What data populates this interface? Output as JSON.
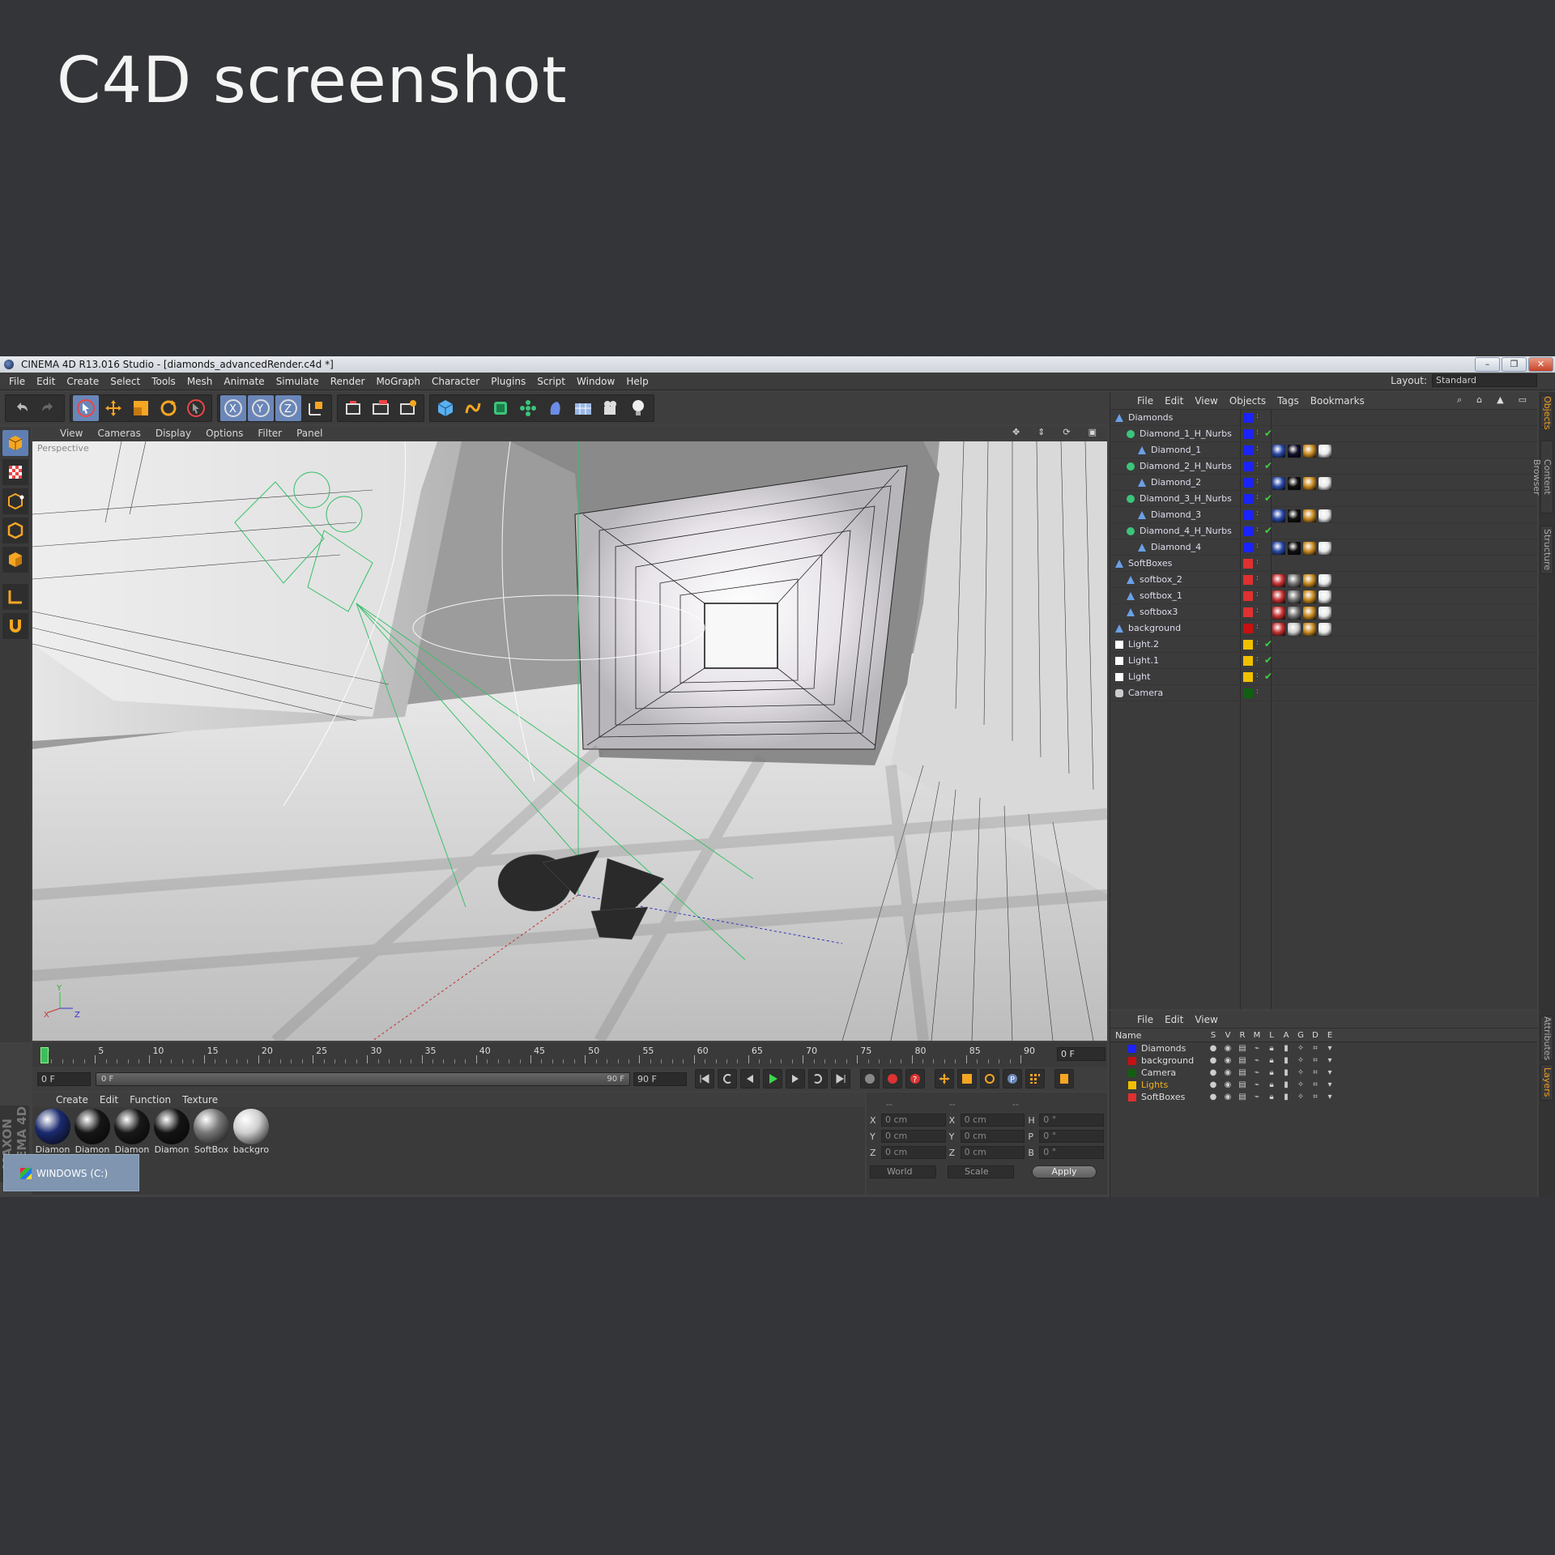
{
  "heading": "C4D screenshot",
  "window": {
    "title": "CINEMA 4D R13.016 Studio - [diamonds_advancedRender.c4d *]",
    "buttons": [
      "–",
      "❐",
      "✕"
    ]
  },
  "menu": [
    "File",
    "Edit",
    "Create",
    "Select",
    "Tools",
    "Mesh",
    "Animate",
    "Simulate",
    "Render",
    "MoGraph",
    "Character",
    "Plugins",
    "Script",
    "Window",
    "Help"
  ],
  "layout": {
    "label": "Layout:",
    "value": "Standard"
  },
  "toolbar_icons": [
    "undo-icon",
    "redo-icon",
    "select-arrow-icon",
    "move-icon",
    "scale-icon",
    "rotate-icon",
    "live-select-icon",
    "x-axis-icon",
    "y-axis-icon",
    "z-axis-icon",
    "coordinate-system-icon",
    "render-view-icon",
    "render-picture-viewer-icon",
    "render-settings-icon",
    "cube-icon",
    "spline-pen-icon",
    "nurbs-icon",
    "array-icon",
    "deformer-icon",
    "scene-floor-icon",
    "camera-icon",
    "light-icon"
  ],
  "left_tools": [
    "model-mode-icon",
    "texture-mode-icon",
    "point-mode-icon",
    "edge-mode-icon",
    "polygon-mode-icon",
    "axis-mode-icon",
    "magnet-icon"
  ],
  "viewport": {
    "menu": [
      "View",
      "Cameras",
      "Display",
      "Options",
      "Filter",
      "Panel"
    ],
    "label": "Perspective",
    "axis_labels": [
      "X",
      "Y",
      "Z"
    ]
  },
  "timeline": {
    "ticks": [
      "0",
      "5",
      "10",
      "15",
      "20",
      "25",
      "30",
      "35",
      "40",
      "45",
      "50",
      "55",
      "60",
      "65",
      "70",
      "75",
      "80",
      "85",
      "90"
    ],
    "current_frame": "0 F",
    "start": "0 F",
    "slider_left": "0 F",
    "slider_right": "90 F",
    "end": "90 F"
  },
  "material_manager": {
    "menu": [
      "Create",
      "Edit",
      "Function",
      "Texture"
    ],
    "materials": [
      {
        "name": "Diamon",
        "color": "#1a2a6e"
      },
      {
        "name": "Diamon",
        "color": "#161616"
      },
      {
        "name": "Diamon",
        "color": "#181818"
      },
      {
        "name": "Diamon",
        "color": "#141414"
      },
      {
        "name": "SoftBox",
        "color": "#777777"
      },
      {
        "name": "backgro",
        "color": "#cfcfcf"
      }
    ]
  },
  "maxon_label": "MAXON CINEMA 4D",
  "taskbar": {
    "label": "WINDOWS (C:)"
  },
  "coordinates": {
    "header": [
      "--",
      "--",
      "--"
    ],
    "rows": [
      {
        "a": "X",
        "av": "0 cm",
        "b": "X",
        "bv": "0 cm",
        "c": "H",
        "cv": "0 °"
      },
      {
        "a": "Y",
        "av": "0 cm",
        "b": "Y",
        "bv": "0 cm",
        "c": "P",
        "cv": "0 °"
      },
      {
        "a": "Z",
        "av": "0 cm",
        "b": "Z",
        "bv": "0 cm",
        "c": "B",
        "cv": "0 °"
      }
    ],
    "world": "World",
    "scale": "Scale",
    "apply": "Apply"
  },
  "object_manager": {
    "menu": [
      "File",
      "Edit",
      "View",
      "Objects",
      "Tags",
      "Bookmarks"
    ],
    "objects": [
      {
        "name": "Diamonds",
        "indent": 0,
        "color": "#1a22ff",
        "check": "",
        "tags": []
      },
      {
        "name": "Diamond_1_H_Nurbs",
        "indent": 1,
        "color": "#1a22ff",
        "check": "✔",
        "tags": []
      },
      {
        "name": "Diamond_1",
        "indent": 2,
        "color": "#1a22ff",
        "check": "",
        "tags": [
          "#2a4aa8",
          "#10102a",
          "#c98a20",
          "#e8e8e8"
        ]
      },
      {
        "name": "Diamond_2_H_Nurbs",
        "indent": 1,
        "color": "#1a22ff",
        "check": "✔",
        "tags": []
      },
      {
        "name": "Diamond_2",
        "indent": 2,
        "color": "#1a22ff",
        "check": "",
        "tags": [
          "#2a4aa8",
          "#101010",
          "#c98a20",
          "#e8e8e8"
        ]
      },
      {
        "name": "Diamond_3_H_Nurbs",
        "indent": 1,
        "color": "#1a22ff",
        "check": "✔",
        "tags": []
      },
      {
        "name": "Diamond_3",
        "indent": 2,
        "color": "#1a22ff",
        "check": "",
        "tags": [
          "#2a4aa8",
          "#101010",
          "#c98a20",
          "#e8e8e8"
        ]
      },
      {
        "name": "Diamond_4_H_Nurbs",
        "indent": 1,
        "color": "#1a22ff",
        "check": "✔",
        "tags": []
      },
      {
        "name": "Diamond_4",
        "indent": 2,
        "color": "#1a22ff",
        "check": "",
        "tags": [
          "#2a4aa8",
          "#101010",
          "#c98a20",
          "#e8e8e8"
        ]
      },
      {
        "name": "SoftBoxes",
        "indent": 0,
        "color": "#e03030",
        "check": "",
        "tags": []
      },
      {
        "name": "softbox_2",
        "indent": 1,
        "color": "#e03030",
        "check": "",
        "tags": [
          "#c83232",
          "#777777",
          "#c98a20",
          "#e8e8e8"
        ]
      },
      {
        "name": "softbox_1",
        "indent": 1,
        "color": "#e03030",
        "check": "",
        "tags": [
          "#c83232",
          "#777777",
          "#c98a20",
          "#e8e8e8"
        ]
      },
      {
        "name": "softbox3",
        "indent": 1,
        "color": "#e03030",
        "check": "",
        "tags": [
          "#c83232",
          "#777777",
          "#c98a20",
          "#e8e8e8"
        ]
      },
      {
        "name": "background",
        "indent": 0,
        "color": "#c81010",
        "check": "",
        "tags": [
          "#c83232",
          "#cfcfcf",
          "#c98a20",
          "#e8e8e8"
        ]
      },
      {
        "name": "Light.2",
        "indent": 0,
        "color": "#f0c000",
        "check": "✔",
        "tags": []
      },
      {
        "name": "Light.1",
        "indent": 0,
        "color": "#f0c000",
        "check": "✔",
        "tags": []
      },
      {
        "name": "Light",
        "indent": 0,
        "color": "#f0c000",
        "check": "✔",
        "tags": []
      },
      {
        "name": "Camera",
        "indent": 0,
        "color": "#106010",
        "check": "",
        "tags": []
      }
    ]
  },
  "layer_manager": {
    "menu": [
      "File",
      "Edit",
      "View"
    ],
    "header": "Name",
    "columns": [
      "S",
      "V",
      "R",
      "M",
      "L",
      "A",
      "G",
      "D",
      "E"
    ],
    "layers": [
      {
        "name": "Diamonds",
        "color": "#1a22ff",
        "text_color": "#dddddd"
      },
      {
        "name": "background",
        "color": "#c81010",
        "text_color": "#dddddd"
      },
      {
        "name": "Camera",
        "color": "#106010",
        "text_color": "#dddddd"
      },
      {
        "name": "Lights",
        "color": "#f0c000",
        "text_color": "#f0b020"
      },
      {
        "name": "SoftBoxes",
        "color": "#e03030",
        "text_color": "#dddddd"
      }
    ]
  },
  "side_tabs": [
    "Objects",
    "Content Browser",
    "Structure",
    "Attributes",
    "Layers"
  ]
}
